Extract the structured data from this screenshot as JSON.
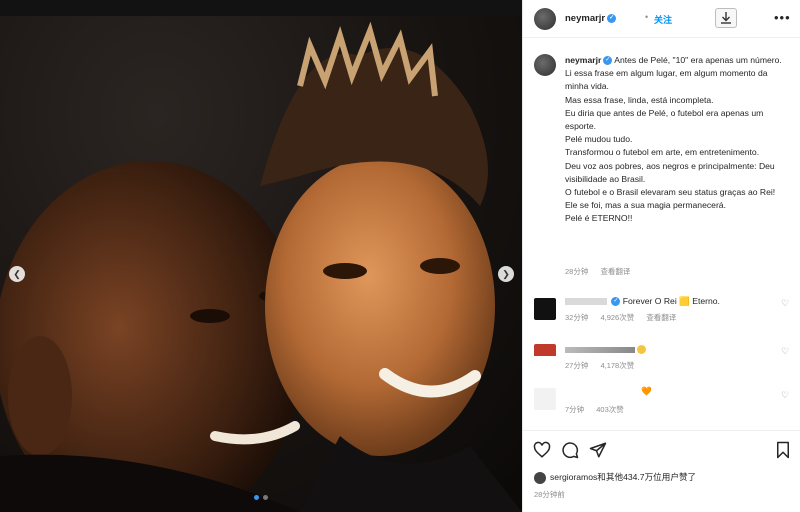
{
  "post": {
    "username": "neymarjr",
    "follow_label": "关注",
    "separator": "•",
    "more_label": "•••"
  },
  "caption": {
    "username": "neymarjr",
    "text": "Antes de Pelé, \"10\" era apenas um número.\nLi essa frase em algum lugar, em algum momento da minha vida.\nMas essa frase, linda, está incompleta.\nEu diria que antes de Pelé, o futebol era apenas um esporte.\nPelé mudou tudo.\nTransformou o futebol em arte, em entretenimento.\nDeu voz aos pobres, aos negros e principalmente: Deu visibilidade ao Brasil.\nO futebol e o Brasil elevaram seu status graças ao Rei!\nEle se foi, mas a sua magia permanecerá.\nPelé é ETERNO!!",
    "time": "28分钟",
    "translate": "查看翻译"
  },
  "comments": [
    {
      "text": "Forever O Rei 🟨 Eterno.",
      "time": "32分钟",
      "likes": "4,926次赞",
      "translate": "查看翻译"
    },
    {
      "text": "",
      "time": "27分钟",
      "likes": "4,178次赞"
    },
    {
      "text": "🧡",
      "time": "7分钟",
      "likes": "403次赞"
    }
  ],
  "actions": {
    "like": "heart-icon",
    "comment": "comment-icon",
    "share": "share-icon",
    "save": "bookmark-icon"
  },
  "likes": {
    "text": "sergioramos和其他434.7万位用户赞了"
  },
  "posted": "28分钟前",
  "colors": {
    "accent": "#0095f6",
    "verified": "#3897f0",
    "muted": "#8e8e8e"
  }
}
